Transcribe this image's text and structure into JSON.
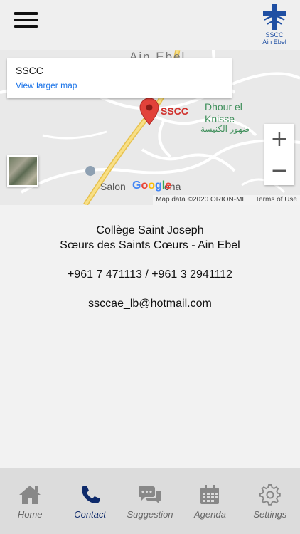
{
  "header": {
    "menu_icon": "hamburger-menu-icon",
    "logo": {
      "line1": "SSCC",
      "line2": "Ain Ebel",
      "icon": "cross-logo-icon"
    }
  },
  "map": {
    "card_title": "SSCC",
    "card_link": "View larger map",
    "marker_label": "SSCC",
    "places": {
      "ain_ebel": "Ain Ebel",
      "dhour_el_knisse_line1": "Dhour el",
      "dhour_el_knisse_line2": "Knisse",
      "dhour_el_knisse_arabic": "ضهور الكنيسة",
      "salon": "Salon",
      "doha": "oha"
    },
    "zoom_in": "+",
    "zoom_out": "−",
    "google": "Google",
    "map_data": "Map data ©2020 ORION-ME",
    "terms": "Terms of Use",
    "colors": {
      "road_major": "#f5d36b",
      "marker": "#d0312d",
      "link": "#1a73e8"
    }
  },
  "contact": {
    "school_name": "Collège Saint Joseph",
    "congregation": "Sœurs des Saints Cœurs - Ain Ebel",
    "phones": "+961 7 471113 / +961 3 2941112",
    "email": "ssccae_lb@hotmail.com"
  },
  "nav": {
    "items": [
      {
        "label": "Home",
        "icon": "home-icon",
        "active": false
      },
      {
        "label": "Contact",
        "icon": "phone-icon",
        "active": true
      },
      {
        "label": "Suggestion",
        "icon": "chat-bubbles-icon",
        "active": false
      },
      {
        "label": "Agenda",
        "icon": "calendar-icon",
        "active": false
      },
      {
        "label": "Settings",
        "icon": "gear-icon",
        "active": false
      }
    ],
    "colors": {
      "active": "#0e2a6b",
      "inactive": "#666666"
    }
  }
}
